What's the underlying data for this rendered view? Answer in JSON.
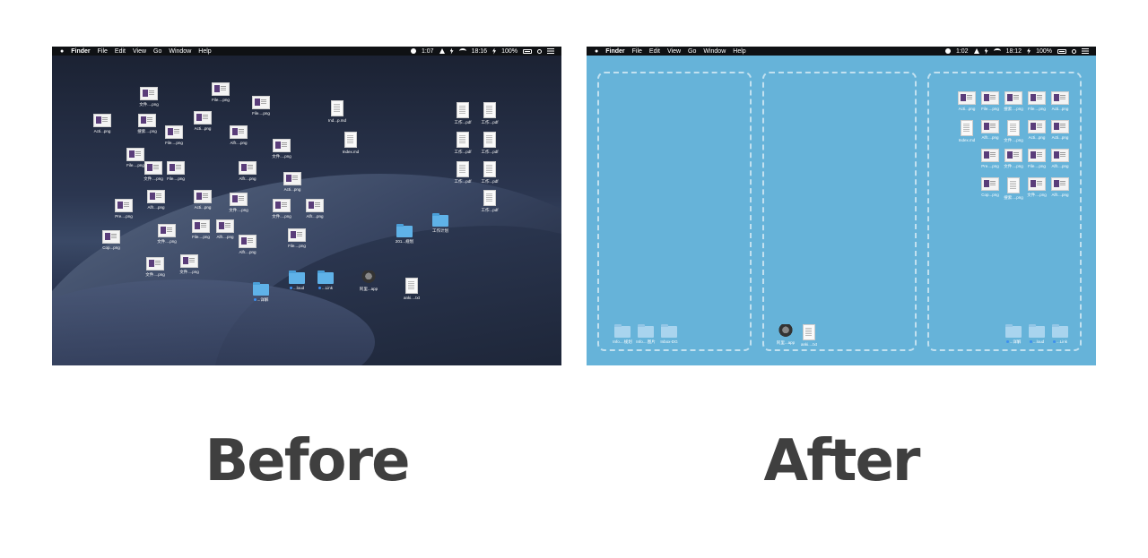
{
  "menubar": {
    "before": {
      "app": "Finder",
      "items": [
        "File",
        "Edit",
        "View",
        "Go",
        "Window",
        "Help"
      ],
      "status_time_left": "1:07",
      "clock": "18:16",
      "battery": "100%"
    },
    "after": {
      "app": "Finder",
      "items": [
        "File",
        "Edit",
        "View",
        "Go",
        "Window",
        "Help"
      ],
      "status_time_left": "1:02",
      "clock": "18:12",
      "battery": "100%"
    }
  },
  "before_icons": [
    {
      "label": "文件....png",
      "type": "thumb"
    },
    {
      "label": "File....png",
      "type": "thumb"
    },
    {
      "label": "File....png",
      "type": "thumb"
    },
    {
      "label": "Acti...png",
      "type": "thumb"
    },
    {
      "label": "搜索....png",
      "type": "thumb"
    },
    {
      "label": "File....png",
      "type": "thumb"
    },
    {
      "label": "Acti...png",
      "type": "thumb"
    },
    {
      "label": "Alfr....png",
      "type": "thumb"
    },
    {
      "label": "Ind...p.md",
      "type": "doc"
    },
    {
      "label": "Index.md",
      "type": "doc"
    },
    {
      "label": "工作...pdf",
      "type": "doc"
    },
    {
      "label": "工作...pdf",
      "type": "doc"
    },
    {
      "label": "工作...pdf",
      "type": "doc"
    },
    {
      "label": "工作...pdf",
      "type": "doc"
    },
    {
      "label": "工作...pdf",
      "type": "doc"
    },
    {
      "label": "工作...pdf",
      "type": "doc"
    },
    {
      "label": "工作...pdf",
      "type": "doc"
    },
    {
      "label": "File....png",
      "type": "thumb"
    },
    {
      "label": "文件....png",
      "type": "thumb"
    },
    {
      "label": "File....png",
      "type": "thumb"
    },
    {
      "label": "Alfr....png",
      "type": "thumb"
    },
    {
      "label": "文件....png",
      "type": "thumb"
    },
    {
      "label": "Acti...png",
      "type": "thumb"
    },
    {
      "label": "Alfr....png",
      "type": "thumb"
    },
    {
      "label": "Pre....png",
      "type": "thumb"
    },
    {
      "label": "Acti...png",
      "type": "thumb"
    },
    {
      "label": "文件....png",
      "type": "thumb"
    },
    {
      "label": "文件....png",
      "type": "thumb"
    },
    {
      "label": "Alfr....png",
      "type": "thumb"
    },
    {
      "label": "Cop...png",
      "type": "thumb"
    },
    {
      "label": "文件....png",
      "type": "thumb"
    },
    {
      "label": "File....png",
      "type": "thumb"
    },
    {
      "label": "Alfr....png",
      "type": "thumb"
    },
    {
      "label": "Alfr....png",
      "type": "thumb"
    },
    {
      "label": "File....png",
      "type": "thumb"
    },
    {
      "label": "文件....png",
      "type": "thumb"
    },
    {
      "label": "文件....png",
      "type": "thumb"
    },
    {
      "label": "201...规划",
      "type": "folder"
    },
    {
      "label": "工作计划",
      "type": "folder"
    },
    {
      "label": "...详解",
      "type": "folder",
      "tag": true
    },
    {
      "label": "...loud",
      "type": "folder",
      "tag": true
    },
    {
      "label": "...Link",
      "type": "folder",
      "tag": true
    },
    {
      "label": "阿里...app",
      "type": "app"
    },
    {
      "label": "anki....txt",
      "type": "doc"
    }
  ],
  "after_icons_right": [
    {
      "label": "Acti...png",
      "type": "thumb"
    },
    {
      "label": "File....png",
      "type": "thumb"
    },
    {
      "label": "搜索....png",
      "type": "thumb"
    },
    {
      "label": "File....png",
      "type": "thumb"
    },
    {
      "label": "Acti...png",
      "type": "thumb"
    },
    {
      "label": "Index.md",
      "type": "doc"
    },
    {
      "label": "Alfr....png",
      "type": "thumb"
    },
    {
      "label": "文件....png",
      "type": "doc"
    },
    {
      "label": "Acti...png",
      "type": "thumb"
    },
    {
      "label": "Acti...png",
      "type": "thumb"
    },
    {
      "label": "Pre....png",
      "type": "thumb"
    },
    {
      "label": "文件....png",
      "type": "thumb"
    },
    {
      "label": "File....png",
      "type": "thumb"
    },
    {
      "label": "Alfr....png",
      "type": "thumb"
    },
    {
      "label": "Cop...png",
      "type": "thumb"
    },
    {
      "label": "搜索....png",
      "type": "doc"
    },
    {
      "label": "文件....png",
      "type": "thumb"
    },
    {
      "label": "Alfr....png",
      "type": "thumb"
    }
  ],
  "after_zone1_icons": [
    {
      "label": "Info....规划",
      "type": "folder"
    },
    {
      "label": "Info....图片",
      "type": "folder"
    },
    {
      "label": "Inbox-DG",
      "type": "folder"
    }
  ],
  "after_zone2_icons": [
    {
      "label": "阿里...app",
      "type": "app"
    },
    {
      "label": "anki....txt",
      "type": "doc"
    }
  ],
  "after_zone3_bottom": [
    {
      "label": "...详解",
      "type": "folder",
      "tag": true
    },
    {
      "label": "...loud",
      "type": "folder",
      "tag": true
    },
    {
      "label": "...Link",
      "type": "folder",
      "tag": true
    }
  ],
  "captions": {
    "before": "Before",
    "after": "After"
  }
}
